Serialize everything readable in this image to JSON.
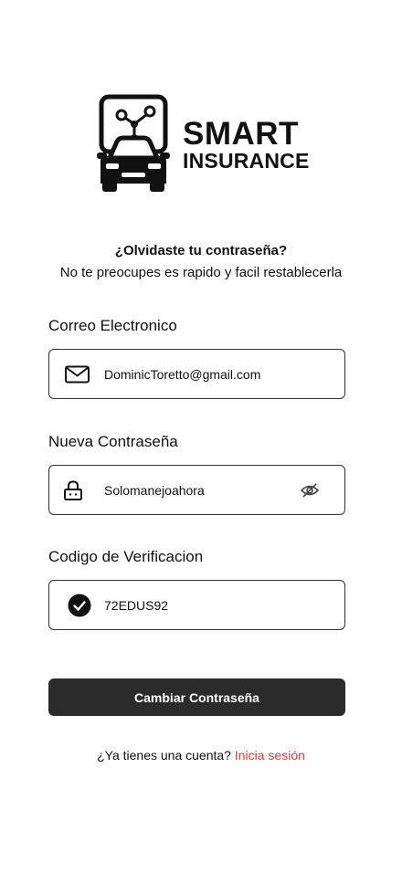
{
  "brand": {
    "word1": "SMART",
    "word2": "INSURANCE"
  },
  "header": {
    "title": "¿Olvidaste tu contraseña?",
    "subtitle": "No te preocupes es rapido y facil restablecerla"
  },
  "fields": {
    "email": {
      "label": "Correo Electronico",
      "value": "DominicToretto@gmail.com",
      "icon": "mail-icon"
    },
    "password": {
      "label": "Nueva Contraseña",
      "value": "Solomanejoahora",
      "icon": "lock-icon",
      "toggle_icon": "eye-off-icon"
    },
    "code": {
      "label": "Codigo de Verificacion",
      "value": "72EDUS92",
      "icon": "check-circle-icon"
    }
  },
  "actions": {
    "submit_label": "Cambiar Contraseña"
  },
  "footer": {
    "prompt": "¿Ya tienes una cuenta? ",
    "link_label": "Inicia sesión"
  },
  "colors": {
    "button_bg": "#2b2b2b",
    "link": "#e53935",
    "border": "#333333",
    "text": "#111111"
  }
}
